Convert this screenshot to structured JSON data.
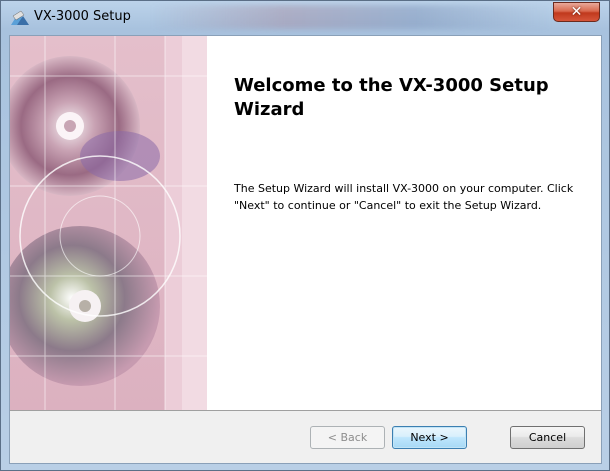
{
  "window": {
    "title": "VX-3000 Setup",
    "close_glyph": "✕",
    "app_icon": "setup-installer-icon"
  },
  "content": {
    "title": "Welcome to the VX-3000 Setup Wizard",
    "body": "The Setup Wizard will install VX-3000 on your computer. Click \"Next\" to continue or \"Cancel\" to exit the Setup Wizard."
  },
  "buttons": {
    "back": "< Back",
    "next": "Next >",
    "cancel": "Cancel"
  },
  "colors": {
    "close_button": "#c7432a",
    "banner_pink": "#e7c7d0",
    "accent_blue": "#3c7fb1"
  }
}
